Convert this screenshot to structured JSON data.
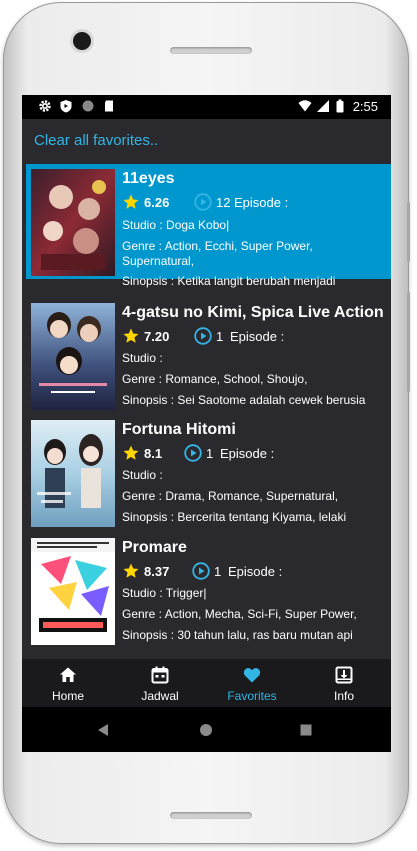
{
  "status_bar": {
    "time": "2:55",
    "icons": [
      "gear-icon",
      "shield-icon",
      "circle-icon",
      "sd-card-icon",
      "wifi-icon",
      "signal-icon",
      "battery-icon"
    ]
  },
  "clear_favorites": "Clear all favorites..",
  "accent_color": "#33b5e5",
  "selected_color": "#0097cf",
  "items": [
    {
      "title": "11eyes",
      "rating": "6.26",
      "episodes": "12",
      "episode_label": "Episode :",
      "studio": "Studio : Doga Kobo|",
      "genre": "Genre : Action, Ecchi, Super Power,",
      "genre2": "Supernatural,",
      "sinopsis": "Sinopsis : Ketika langit berubah menjadi",
      "selected": true
    },
    {
      "title": "4-gatsu no Kimi, Spica Live Action",
      "rating": "7.20",
      "episodes": "1",
      "episode_label": "Episode :",
      "studio": "Studio :",
      "genre": "Genre : Romance, School, Shoujo,",
      "sinopsis": "Sinopsis : Sei Saotome adalah  cewek berusia",
      "selected": false
    },
    {
      "title": "Fortuna Hitomi",
      "rating": "8.1",
      "episodes": "1",
      "episode_label": "Episode :",
      "studio": "Studio :",
      "genre": "Genre : Drama, Romance, Supernatural,",
      "sinopsis": "Sinopsis : Bercerita tentang Kiyama, lelaki",
      "selected": false
    },
    {
      "title": "Promare",
      "rating": "8.37",
      "episodes": "1",
      "episode_label": "Episode :",
      "studio": "Studio : Trigger|",
      "genre": "Genre : Action, Mecha, Sci-Fi, Super Power,",
      "sinopsis": "Sinopsis : 30 tahun lalu, ras baru mutan api",
      "selected": false
    }
  ],
  "nav": [
    {
      "label": "Home",
      "icon": "home-icon"
    },
    {
      "label": "Jadwal",
      "icon": "calendar-icon"
    },
    {
      "label": "Favorites",
      "icon": "heart-icon",
      "active": true
    },
    {
      "label": "Info",
      "icon": "download-box-icon"
    }
  ],
  "system_nav": [
    "back-icon",
    "home-circle-icon",
    "recents-icon"
  ]
}
